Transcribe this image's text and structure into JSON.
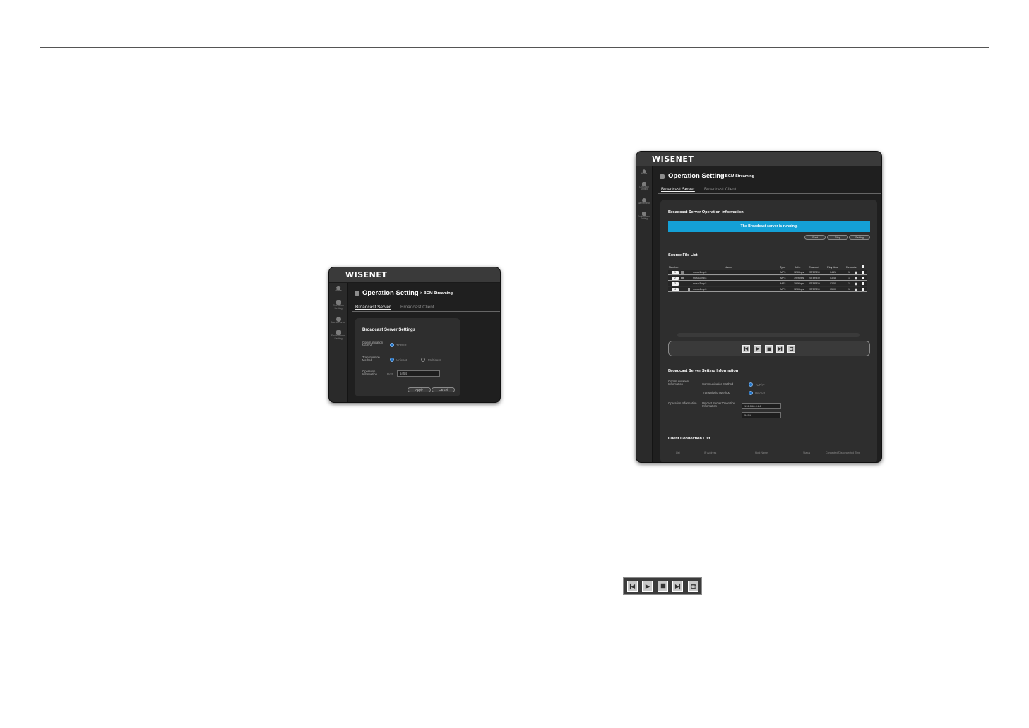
{
  "app": {
    "logo": "WISENET"
  },
  "sidebar": {
    "items": [
      {
        "label": "Home",
        "icon": "home-icon"
      },
      {
        "label": "Operation Setting",
        "icon": "operation-setting-icon"
      },
      {
        "label": "Maintenance",
        "icon": "maintenance-icon"
      },
      {
        "label": "Environment Setting",
        "icon": "environment-setting-icon"
      }
    ]
  },
  "page": {
    "title": "Operation Setting",
    "subtitle": "> BGM Streaming"
  },
  "tabs": [
    {
      "label": "Broadcast Server",
      "active": true
    },
    {
      "label": "Broadcast Client",
      "active": false
    }
  ],
  "settings_window": {
    "section_title": "Broadcast Server Settings",
    "communication_method_label": "Communication Method",
    "communication_option": "TCP/IP",
    "transmission_method_label": "Transmission Method",
    "unicast_label": "Unicast",
    "multicast_label": "Multicast",
    "operation_information_label": "Operation Information",
    "port_label": "Port",
    "port_value": "5454",
    "apply_label": "Apply",
    "cancel_label": "Cancel"
  },
  "server_window": {
    "operation_info_title": "Broadcast Server Operation Information",
    "status_message": "The Broadcast server is running.",
    "start_label": "Start",
    "stop_label": "Stop",
    "setting_label": "Setting",
    "source_list_title": "Source File List",
    "columns": {
      "number": "Number",
      "name": "Name",
      "type": "Type",
      "info": "Info.",
      "channel": "Channel",
      "play_time": "Play time",
      "repeats": "Repeats"
    },
    "files": [
      {
        "number": "1",
        "name": "music1.mp3",
        "type": "MP3",
        "info": "128Kbps",
        "channel": "STEREO",
        "play_time": "04:21",
        "repeats": "1"
      },
      {
        "number": "2",
        "name": "music2.mp3",
        "type": "MP3",
        "info": "192Kbps",
        "channel": "STEREO",
        "play_time": "03:45",
        "repeats": "1"
      },
      {
        "number": "3",
        "name": "music3.mp3",
        "type": "MP3",
        "info": "192Kbps",
        "channel": "STEREO",
        "play_time": "03:52",
        "repeats": "1"
      },
      {
        "number": "4",
        "name": "music4.mp3",
        "type": "MP3",
        "info": "128Kbps",
        "channel": "STEREO",
        "play_time": "05:00",
        "repeats": "1"
      }
    ],
    "setting_info_title": "Broadcast Server Setting Information",
    "communication_information_label": "Communication Information",
    "communication_method_label": "Communication Method",
    "communication_value": "TCP/IP",
    "transmission_method_label": "Transmission Method",
    "transmission_value": "Unicast",
    "operation_information_label": "Operation Information",
    "unicast_server_label": "Unicast Server Operation Information",
    "server_ip": "192.168.0.24",
    "server_port": "5454",
    "client_list_title": "Client Connection List",
    "client_columns": {
      "list": "List",
      "ip": "IP Address",
      "host": "Host Name",
      "status": "Status",
      "time": "Connected/Disconnected Time"
    }
  },
  "controls": [
    "skip-back-icon",
    "play-icon",
    "stop-icon",
    "skip-forward-icon",
    "repeat-icon"
  ],
  "colors": {
    "accent": "#14a0d6",
    "radio": "#1e73c8",
    "window": "#1f1f1f"
  }
}
